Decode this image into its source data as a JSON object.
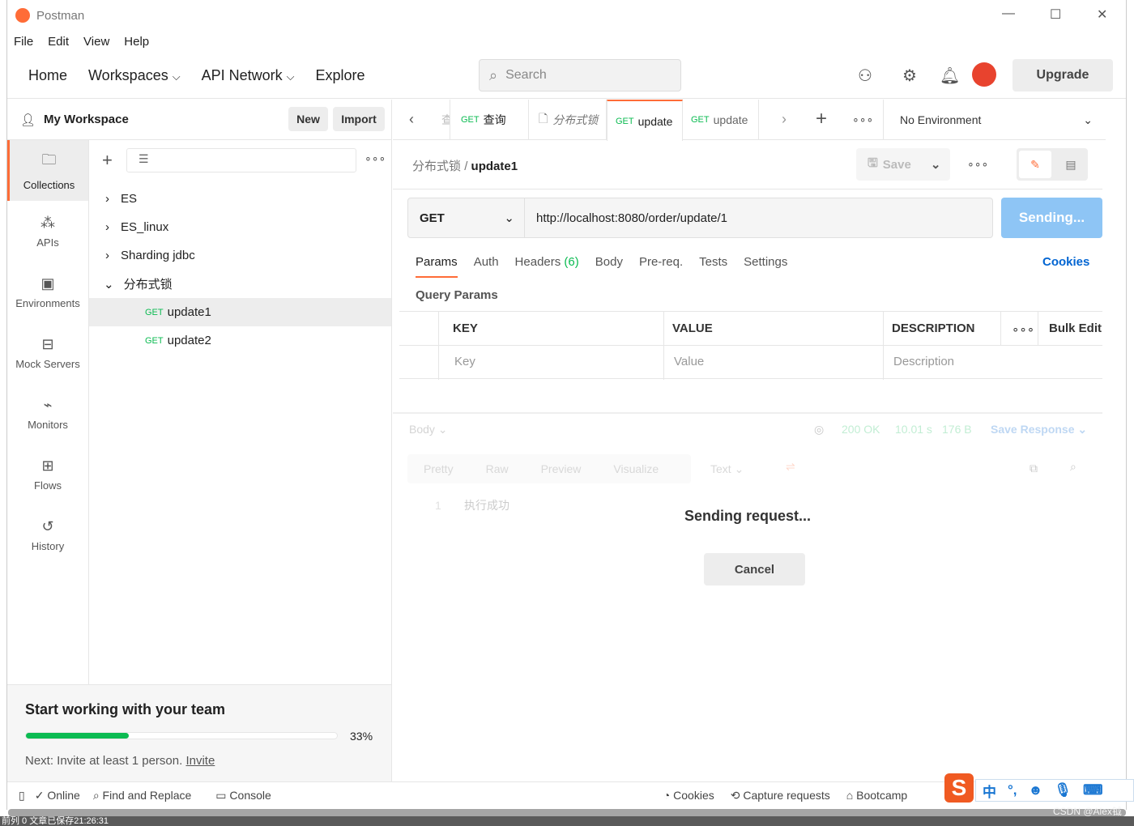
{
  "app": {
    "title": "Postman"
  },
  "menu": [
    "File",
    "Edit",
    "View",
    "Help"
  ],
  "topnav": {
    "home": "Home",
    "workspaces": "Workspaces",
    "api_network": "API Network",
    "explore": "Explore",
    "search_placeholder": "Search",
    "upgrade": "Upgrade"
  },
  "workspace": {
    "name": "My Workspace",
    "new": "New",
    "import": "Import"
  },
  "leftnav": [
    {
      "label": "Collections",
      "icon": "collections-icon"
    },
    {
      "label": "APIs",
      "icon": "apis-icon"
    },
    {
      "label": "Environments",
      "icon": "environments-icon"
    },
    {
      "label": "Mock Servers",
      "icon": "mock-servers-icon"
    },
    {
      "label": "Monitors",
      "icon": "monitors-icon"
    },
    {
      "label": "Flows",
      "icon": "flows-icon"
    },
    {
      "label": "History",
      "icon": "history-icon"
    }
  ],
  "collections": [
    {
      "name": "ES"
    },
    {
      "name": "ES_linux"
    },
    {
      "name": "Sharding jdbc"
    },
    {
      "name": "分布式锁",
      "expanded": true
    }
  ],
  "requests": [
    {
      "method": "GET",
      "name": "update1",
      "selected": true
    },
    {
      "method": "GET",
      "name": "update2"
    }
  ],
  "team": {
    "title": "Start working with your team",
    "progress": 33,
    "progress_label": "33%",
    "next": "Next: Invite at least 1 person.",
    "invite": "Invite",
    "accent": "#0cbb52"
  },
  "tabs": [
    {
      "method": "",
      "label": "查询"
    },
    {
      "method": "GET",
      "label": "查询"
    },
    {
      "method": "",
      "label": "分布式锁"
    },
    {
      "method": "GET",
      "label": "update",
      "active": true
    },
    {
      "method": "GET",
      "label": "update"
    }
  ],
  "environment": "No Environment",
  "request": {
    "breadcrumb_parent": "分布式锁",
    "breadcrumb_sep": "/",
    "name": "update1",
    "save": "Save",
    "method": "GET",
    "url": "http://localhost:8080/order/update/1",
    "send": "Sending..."
  },
  "req_tabs": {
    "params": "Params",
    "auth": "Auth",
    "headers": "Headers",
    "headers_count": "(6)",
    "body": "Body",
    "prereq": "Pre-req.",
    "tests": "Tests",
    "settings": "Settings",
    "cookies": "Cookies"
  },
  "params": {
    "title": "Query Params",
    "headers": [
      "KEY",
      "VALUE",
      "DESCRIPTION"
    ],
    "bulk_edit": "Bulk Edit",
    "placeholders": [
      "Key",
      "Value",
      "Description"
    ]
  },
  "response": {
    "body": "Body",
    "status": "200 OK",
    "time": "10.01 s",
    "size": "176 B",
    "save_response": "Save Response",
    "views": [
      "Pretty",
      "Raw",
      "Preview",
      "Visualize"
    ],
    "format": "Text",
    "line_no": "1",
    "line": "执行成功",
    "sending": "Sending request...",
    "cancel": "Cancel"
  },
  "statusbar": {
    "online": "Online",
    "find_replace": "Find and Replace",
    "console": "Console",
    "cookies": "Cookies",
    "capture": "Capture requests",
    "bootcamp": "Bootcamp"
  },
  "ime": {
    "lang": "中",
    "punct": "°,"
  },
  "watermark": "CSDN @Alex钺",
  "editor_status": "前列 0  文章已保存21:26:31"
}
